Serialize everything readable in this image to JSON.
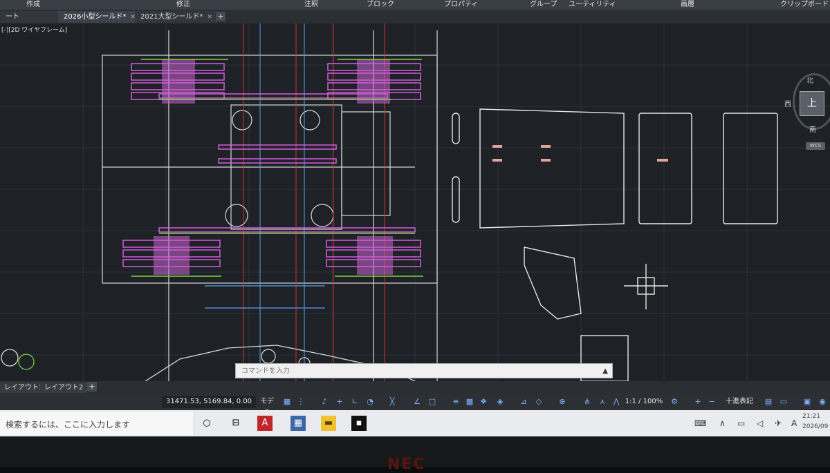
{
  "ribbon": {
    "panels": [
      "作成",
      "修正",
      "注釈",
      "ブロック",
      "プロパティ",
      "グループ",
      "ユーティリティ",
      "画層",
      "クリップボード"
    ]
  },
  "tabs": [
    {
      "label": "ート"
    },
    {
      "label": "2026小型シールド*"
    },
    {
      "label": "2021大型シールド*"
    }
  ],
  "viewport": {
    "label": "[-][2D ワイヤフレーム]",
    "viewcube": {
      "north": "北",
      "west": "西",
      "south": "南",
      "top": "上",
      "wcs": "WCS"
    }
  },
  "command": {
    "placeholder": "コマンドを入力"
  },
  "layouts": [
    "レイアウト1",
    "レイアウト2"
  ],
  "status": {
    "coordinates": "31471.53, 5169.84, 0.00",
    "model": "モデル",
    "scale": "1:1 / 100%",
    "units": "十進表記"
  },
  "taskbar": {
    "search_placeholder": "検索するには、ここに入力します",
    "clock_time": "21:21",
    "clock_date": "2026/09"
  },
  "bezel": {
    "brand": "NEC"
  },
  "colors": {
    "canvas": "#1e2227",
    "magenta": "#e060e8",
    "green": "#7ad640",
    "white": "#e6e6e6",
    "red": "#d03030",
    "blue": "#5aa0e8"
  }
}
